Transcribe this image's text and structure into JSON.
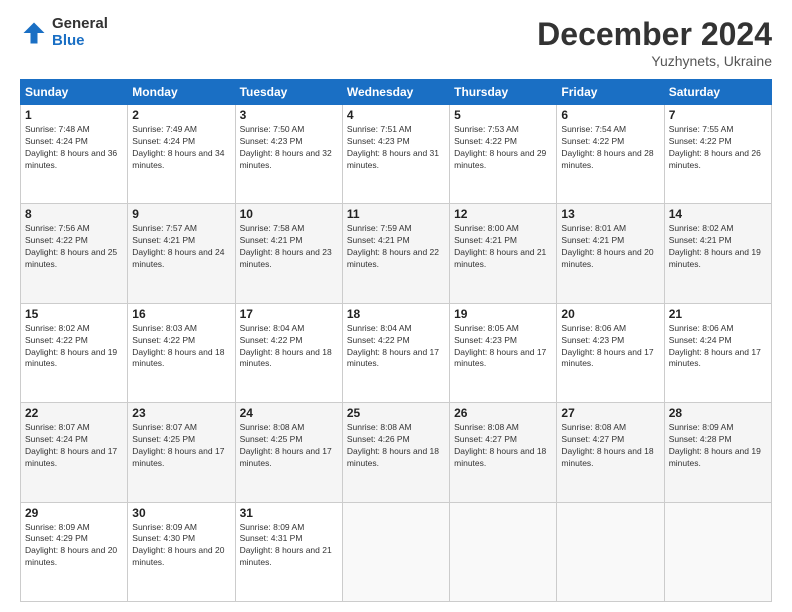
{
  "header": {
    "logo_line1": "General",
    "logo_line2": "Blue",
    "month_title": "December 2024",
    "location": "Yuzhynets, Ukraine"
  },
  "days_of_week": [
    "Sunday",
    "Monday",
    "Tuesday",
    "Wednesday",
    "Thursday",
    "Friday",
    "Saturday"
  ],
  "weeks": [
    [
      {
        "day": "1",
        "sunrise": "7:48 AM",
        "sunset": "4:24 PM",
        "daylight": "8 hours and 36 minutes."
      },
      {
        "day": "2",
        "sunrise": "7:49 AM",
        "sunset": "4:24 PM",
        "daylight": "8 hours and 34 minutes."
      },
      {
        "day": "3",
        "sunrise": "7:50 AM",
        "sunset": "4:23 PM",
        "daylight": "8 hours and 32 minutes."
      },
      {
        "day": "4",
        "sunrise": "7:51 AM",
        "sunset": "4:23 PM",
        "daylight": "8 hours and 31 minutes."
      },
      {
        "day": "5",
        "sunrise": "7:53 AM",
        "sunset": "4:22 PM",
        "daylight": "8 hours and 29 minutes."
      },
      {
        "day": "6",
        "sunrise": "7:54 AM",
        "sunset": "4:22 PM",
        "daylight": "8 hours and 28 minutes."
      },
      {
        "day": "7",
        "sunrise": "7:55 AM",
        "sunset": "4:22 PM",
        "daylight": "8 hours and 26 minutes."
      }
    ],
    [
      {
        "day": "8",
        "sunrise": "7:56 AM",
        "sunset": "4:22 PM",
        "daylight": "8 hours and 25 minutes."
      },
      {
        "day": "9",
        "sunrise": "7:57 AM",
        "sunset": "4:21 PM",
        "daylight": "8 hours and 24 minutes."
      },
      {
        "day": "10",
        "sunrise": "7:58 AM",
        "sunset": "4:21 PM",
        "daylight": "8 hours and 23 minutes."
      },
      {
        "day": "11",
        "sunrise": "7:59 AM",
        "sunset": "4:21 PM",
        "daylight": "8 hours and 22 minutes."
      },
      {
        "day": "12",
        "sunrise": "8:00 AM",
        "sunset": "4:21 PM",
        "daylight": "8 hours and 21 minutes."
      },
      {
        "day": "13",
        "sunrise": "8:01 AM",
        "sunset": "4:21 PM",
        "daylight": "8 hours and 20 minutes."
      },
      {
        "day": "14",
        "sunrise": "8:02 AM",
        "sunset": "4:21 PM",
        "daylight": "8 hours and 19 minutes."
      }
    ],
    [
      {
        "day": "15",
        "sunrise": "8:02 AM",
        "sunset": "4:22 PM",
        "daylight": "8 hours and 19 minutes."
      },
      {
        "day": "16",
        "sunrise": "8:03 AM",
        "sunset": "4:22 PM",
        "daylight": "8 hours and 18 minutes."
      },
      {
        "day": "17",
        "sunrise": "8:04 AM",
        "sunset": "4:22 PM",
        "daylight": "8 hours and 18 minutes."
      },
      {
        "day": "18",
        "sunrise": "8:04 AM",
        "sunset": "4:22 PM",
        "daylight": "8 hours and 17 minutes."
      },
      {
        "day": "19",
        "sunrise": "8:05 AM",
        "sunset": "4:23 PM",
        "daylight": "8 hours and 17 minutes."
      },
      {
        "day": "20",
        "sunrise": "8:06 AM",
        "sunset": "4:23 PM",
        "daylight": "8 hours and 17 minutes."
      },
      {
        "day": "21",
        "sunrise": "8:06 AM",
        "sunset": "4:24 PM",
        "daylight": "8 hours and 17 minutes."
      }
    ],
    [
      {
        "day": "22",
        "sunrise": "8:07 AM",
        "sunset": "4:24 PM",
        "daylight": "8 hours and 17 minutes."
      },
      {
        "day": "23",
        "sunrise": "8:07 AM",
        "sunset": "4:25 PM",
        "daylight": "8 hours and 17 minutes."
      },
      {
        "day": "24",
        "sunrise": "8:08 AM",
        "sunset": "4:25 PM",
        "daylight": "8 hours and 17 minutes."
      },
      {
        "day": "25",
        "sunrise": "8:08 AM",
        "sunset": "4:26 PM",
        "daylight": "8 hours and 18 minutes."
      },
      {
        "day": "26",
        "sunrise": "8:08 AM",
        "sunset": "4:27 PM",
        "daylight": "8 hours and 18 minutes."
      },
      {
        "day": "27",
        "sunrise": "8:08 AM",
        "sunset": "4:27 PM",
        "daylight": "8 hours and 18 minutes."
      },
      {
        "day": "28",
        "sunrise": "8:09 AM",
        "sunset": "4:28 PM",
        "daylight": "8 hours and 19 minutes."
      }
    ],
    [
      {
        "day": "29",
        "sunrise": "8:09 AM",
        "sunset": "4:29 PM",
        "daylight": "8 hours and 20 minutes."
      },
      {
        "day": "30",
        "sunrise": "8:09 AM",
        "sunset": "4:30 PM",
        "daylight": "8 hours and 20 minutes."
      },
      {
        "day": "31",
        "sunrise": "8:09 AM",
        "sunset": "4:31 PM",
        "daylight": "8 hours and 21 minutes."
      },
      null,
      null,
      null,
      null
    ]
  ]
}
